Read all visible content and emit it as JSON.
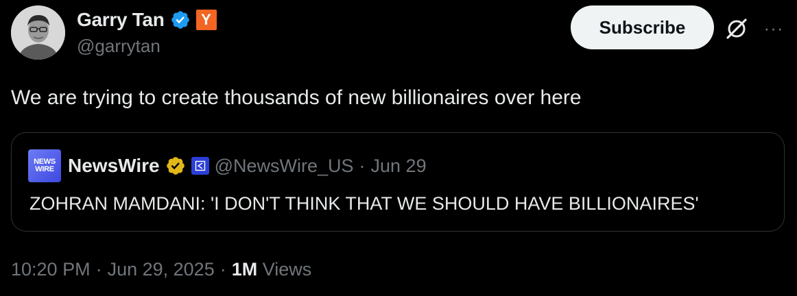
{
  "author": {
    "display_name": "Garry Tan",
    "handle": "@garrytan",
    "badge_y": "Y"
  },
  "header": {
    "subscribe_label": "Subscribe",
    "more_label": "···"
  },
  "tweet": {
    "text": "We are trying to create thousands of new billionaires over here"
  },
  "quote": {
    "logo_line1": "NEWS",
    "logo_line2": "WIRE",
    "display_name": "NewsWire",
    "handle": "@NewsWire_US",
    "separator": "·",
    "date": "Jun 29",
    "text": "ZOHRAN MAMDANI: 'I DON'T THINK THAT WE SHOULD HAVE BILLIONAIRES'"
  },
  "footer": {
    "time": "10:20 PM",
    "sep1": "·",
    "date": "Jun 29, 2025",
    "sep2": "·",
    "views_count": "1M",
    "views_label": "Views"
  },
  "colors": {
    "background": "#000000",
    "text_primary": "#e7e9ea",
    "text_secondary": "#71767b",
    "border": "#2f3336",
    "verified_blue": "#1d9bf0",
    "verified_gold": "#e2b719",
    "yc_orange": "#f26522",
    "subscribe_bg": "#eff3f4"
  },
  "icons": {
    "verified": "verified-blue-check-icon",
    "yc": "y-combinator-badge-icon",
    "grok": "grok-slash-icon",
    "more": "more-horizontal-icon",
    "gold": "verified-gold-check-icon",
    "affiliate": "affiliate-badge-icon"
  }
}
